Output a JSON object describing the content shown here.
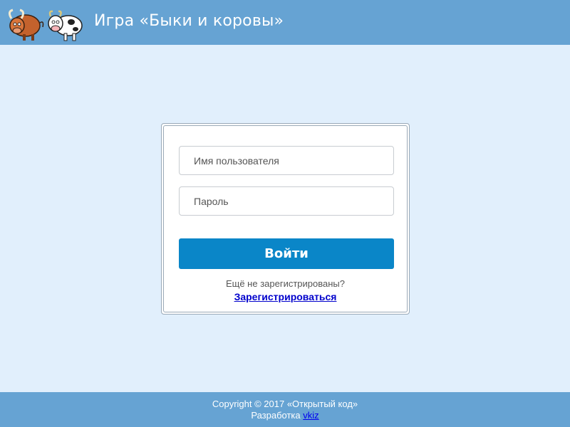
{
  "header": {
    "title": "Игра «Быки и коровы»",
    "logo_icon": "bull-and-cow-logo-icon"
  },
  "login": {
    "username_placeholder": "Имя пользователя",
    "password_placeholder": "Пароль",
    "submit_label": "Войти",
    "register_hint": "Ещё не зарегистрированы?",
    "register_link": "Зарегистрироваться"
  },
  "footer": {
    "copyright": "Copyright © 2017 «Открытый код»",
    "dev_prefix": "Разработка",
    "dev_link": "vkiz"
  },
  "colors": {
    "header_bg": "#66a3d3",
    "page_bg": "#e1effc",
    "button_bg": "#0a86c8",
    "link": "#0000cc"
  }
}
